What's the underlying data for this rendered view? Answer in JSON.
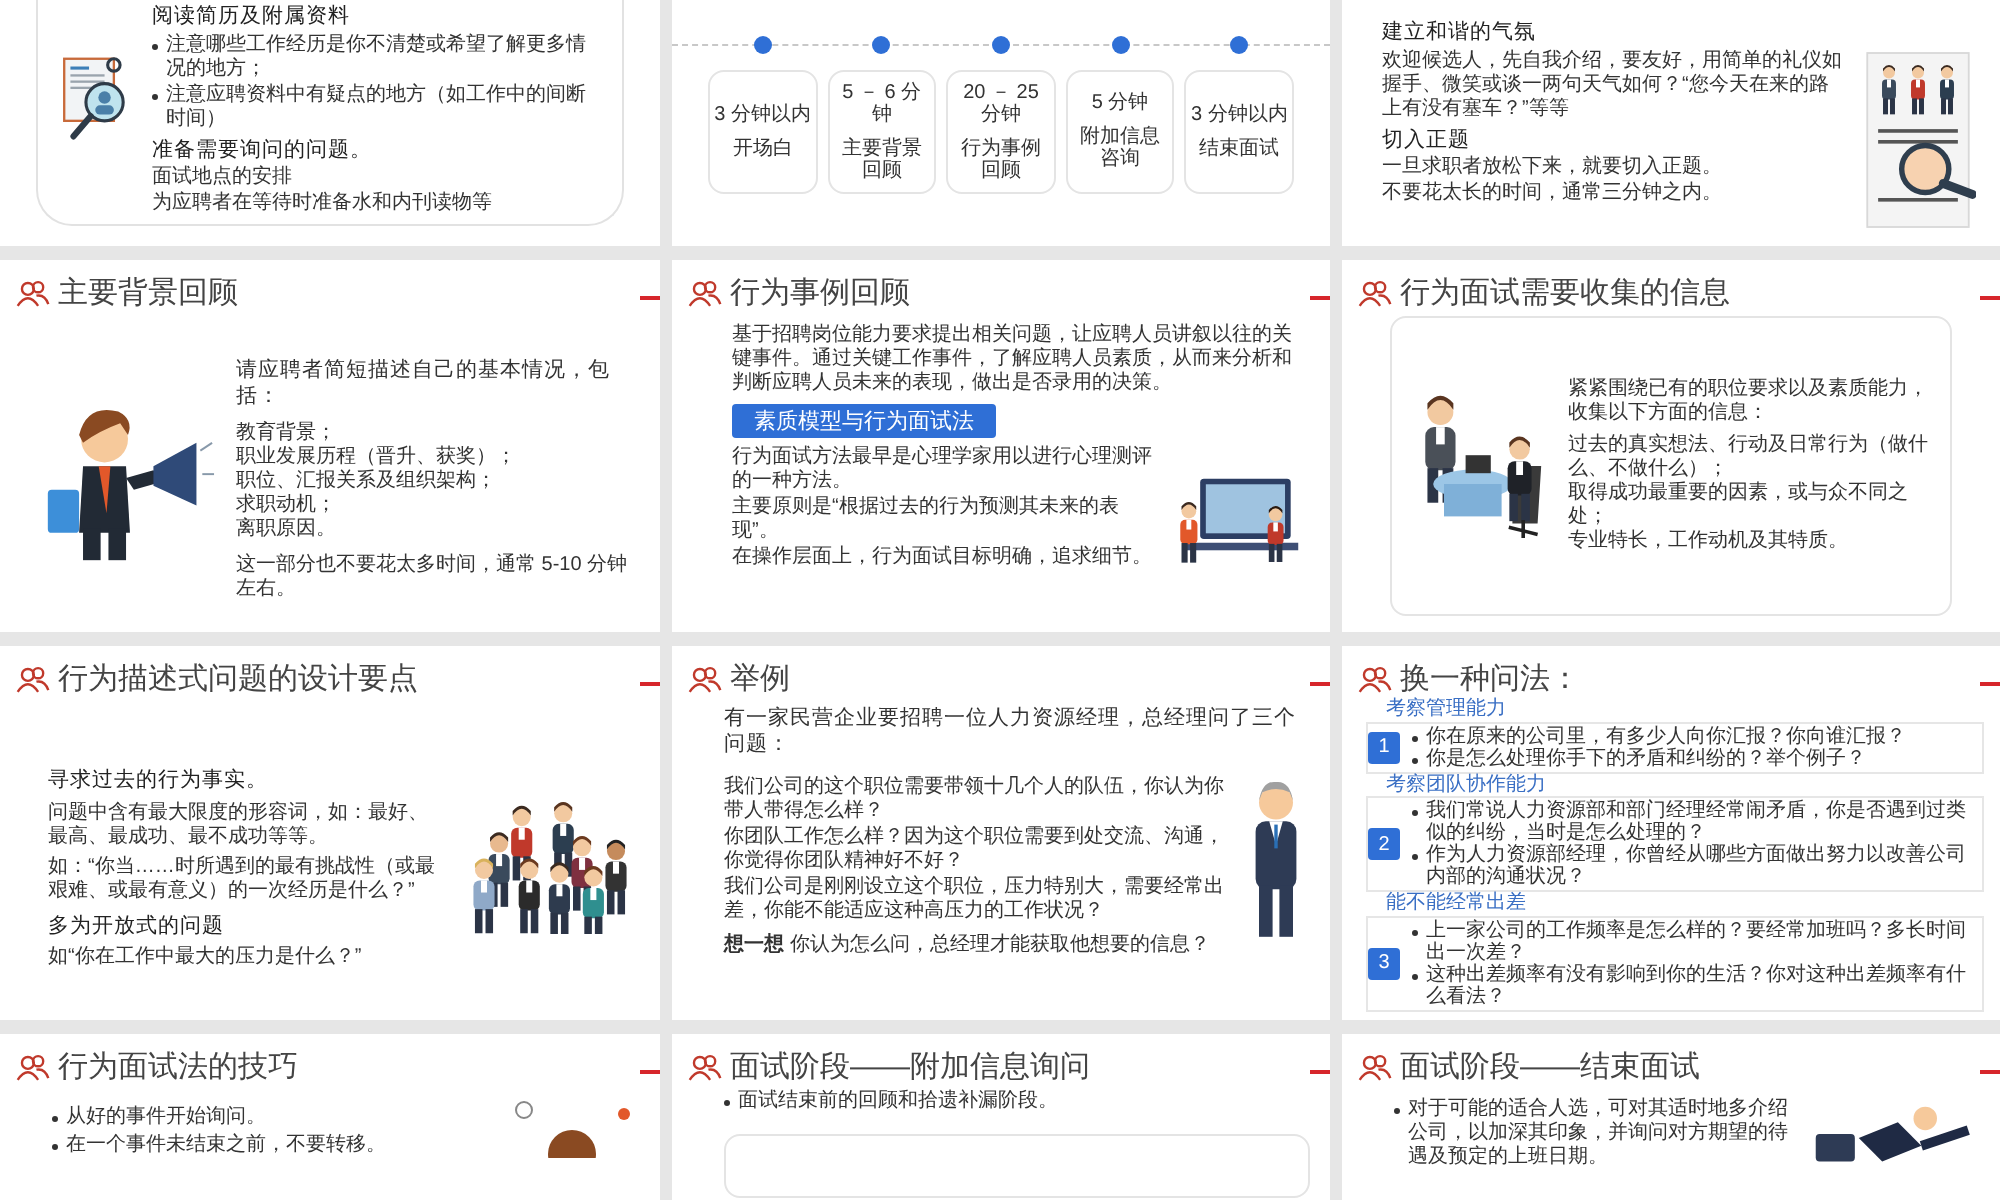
{
  "slides": [
    {
      "kind": "resume",
      "blocks": [
        {
          "kind": "heading",
          "text": "阅读简历及附属资料"
        },
        {
          "kind": "bullet",
          "text": "注意哪些工作经历是你不清楚或希望了解更多情况的地方；"
        },
        {
          "kind": "bullet",
          "text": "注意应聘资料中有疑点的地方（如工作中的间断时间）"
        },
        {
          "kind": "heading",
          "text": "准备需要询问的问题。"
        },
        {
          "kind": "text",
          "text": "面试地点的安排"
        },
        {
          "kind": "text",
          "text": "为应聘者在等待时准备水和内刊读物等"
        }
      ]
    },
    {
      "kind": "timeline",
      "steps": [
        {
          "time": "3 分钟以内",
          "label": "开场白"
        },
        {
          "time": "5 － 6 分钟",
          "label": "主要背景回顾"
        },
        {
          "time": "20 － 25 分钟",
          "label": "行为事例回顾"
        },
        {
          "time": "5 分钟",
          "label": "附加信息咨询"
        },
        {
          "time": "3 分钟以内",
          "label": "结束面试"
        }
      ]
    },
    {
      "kind": "rapport",
      "blocks": [
        {
          "kind": "heading",
          "text": "建立和谐的气氛"
        },
        {
          "kind": "text",
          "text": "欢迎候选人，先自我介绍，要友好，用简单的礼仪如握手、微笑或谈一两句天气如何？“您今天在来的路上有没有塞车？”等等"
        },
        {
          "kind": "heading",
          "text": "切入正题"
        },
        {
          "kind": "text",
          "text": "一旦求职者放松下来，就要切入正题。"
        },
        {
          "kind": "text",
          "text": "不要花太长的时间，通常三分钟之内。"
        }
      ]
    },
    {
      "kind": "background",
      "title": "主要背景回顾",
      "lead": "请应聘者简短描述自己的基本情况，包括：",
      "items": [
        "教育背景；",
        "职业发展历程（晋升、获奖）；",
        "职位、汇报关系及组织架构；",
        "求职动机；",
        "离职原因。"
      ],
      "footer": "这一部分也不要花太多时间，通常 5-10 分钟左右。"
    },
    {
      "kind": "behavior",
      "title": "行为事例回顾",
      "intro": "基于招聘岗位能力要求提出相关问题，让应聘人员讲叙以往的关键事件。通过关键工作事件，了解应聘人员素质，从而来分析和判断应聘人员未来的表现，做出是否录用的决策。",
      "banner": "素质模型与行为面试法",
      "lines": [
        "行为面试方法最早是心理学家用以进行心理测评的一种方法。",
        "主要原则是“根据过去的行为预测其未来的表现”。",
        "在操作层面上，行为面试目标明确，追求细节。"
      ]
    },
    {
      "kind": "collect",
      "title": "行为面试需要收集的信息",
      "lead": "紧紧围绕已有的职位要求以及素质能力，收集以下方面的信息：",
      "items": [
        "过去的真实想法、行动及日常行为（做什么、不做什么）；",
        "取得成功最重要的因素，或与众不同之处；",
        "专业特长，工作动机及其特质。"
      ]
    },
    {
      "kind": "design",
      "title": "行为描述式问题的设计要点",
      "blocks": [
        {
          "kind": "heading",
          "text": "寻求过去的行为事实。"
        },
        {
          "kind": "text",
          "text": "问题中含有最大限度的形容词，如：最好、最高、最成功、最不成功等等。"
        },
        {
          "kind": "text",
          "text": "如：“你当……时所遇到的最有挑战性（或最艰难、或最有意义）的一次经历是什么？”"
        },
        {
          "kind": "heading",
          "text": "多为开放式的问题"
        },
        {
          "kind": "text",
          "text": "如“你在工作中最大的压力是什么？”"
        }
      ]
    },
    {
      "kind": "example",
      "title": "举例",
      "lead": "有一家民营企业要招聘一位人力资源经理，总经理问了三个问题：",
      "questions": [
        "我们公司的这个职位需要带领十几个人的队伍，你认为你带人带得怎么样？",
        "你团队工作怎么样？因为这个职位需要到处交流、沟通，你觉得你团队精神好不好？",
        "我们公司是刚刚设立这个职位，压力特别大，需要经常出差，你能不能适应这种高压力的工作状况？"
      ],
      "prompt": "**想一想** 你认为怎么问，总经理才能获取他想要的信息？"
    },
    {
      "kind": "rephrase",
      "title": "换一种问法：",
      "groups": [
        {
          "heading": "考察管理能力",
          "number": "1",
          "items": [
            "你在原来的公司里，有多少人向你汇报？你向谁汇报？",
            "你是怎么处理你手下的矛盾和纠纷的？举个例子？"
          ]
        },
        {
          "heading": "考察团队协作能力",
          "number": "2",
          "items": [
            "我们常说人力资源部和部门经理经常闹矛盾，你是否遇到过类似的纠纷，当时是怎么处理的？",
            "作为人力资源部经理，你曾经从哪些方面做出努力以改善公司内部的沟通状况？"
          ]
        },
        {
          "heading": "能不能经常出差",
          "number": "3",
          "items": [
            "上一家公司的工作频率是怎么样的？要经常加班吗？多长时间出一次差？",
            "这种出差频率有没有影响到你的生活？你对这种出差频率有什么看法？"
          ]
        }
      ]
    },
    {
      "kind": "tips",
      "title": "行为面试法的技巧",
      "bullets": [
        "从好的事件开始询问。",
        "在一个事件未结束之前，不要转移。"
      ]
    },
    {
      "kind": "extra",
      "title": "面试阶段——附加信息询问",
      "bullets": [
        "面试结束前的回顾和拾遗补漏阶段。"
      ]
    },
    {
      "kind": "closing",
      "title": "面试阶段——结束面试",
      "bullets": [
        "对于可能的适合人选，可对其适时地多介绍公司，以加深其印象，并询问对方期望的待遇及预定的上班日期。"
      ]
    }
  ]
}
